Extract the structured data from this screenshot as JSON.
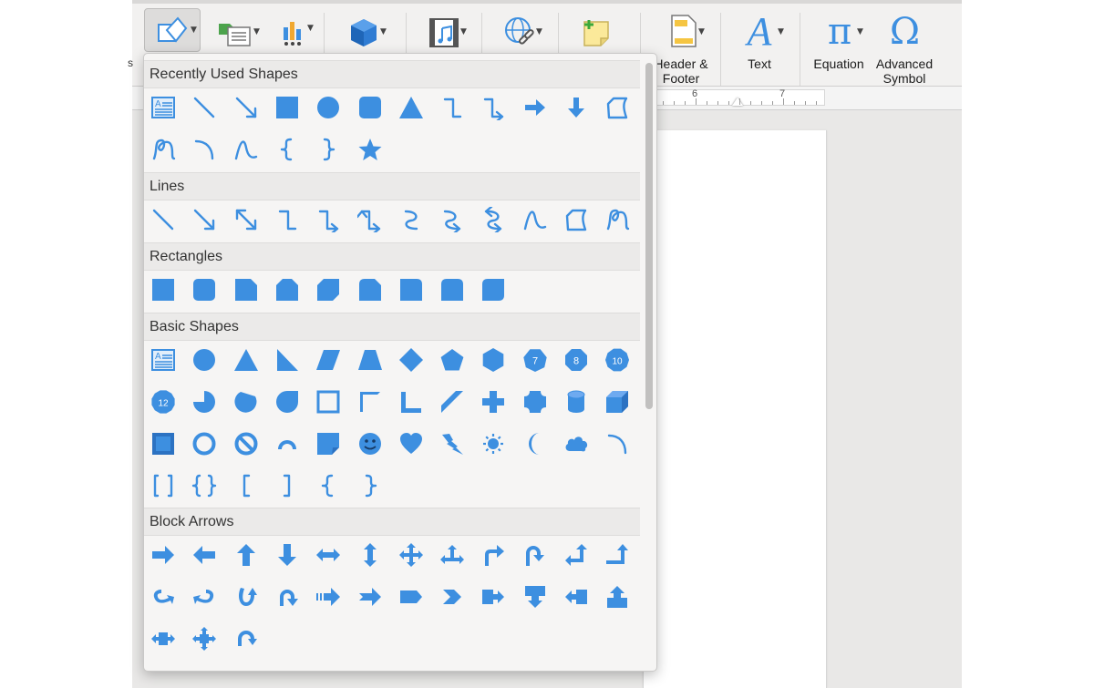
{
  "ribbon": {
    "buttons": [
      {
        "name": "shapes",
        "icon": "shapes-icon"
      },
      {
        "name": "smartart",
        "icon": "smartart-icon"
      },
      {
        "name": "chart",
        "icon": "chart-icon"
      },
      {
        "name": "3d-models",
        "icon": "3d-cube-icon"
      },
      {
        "name": "media",
        "icon": "video-icon"
      },
      {
        "name": "links",
        "icon": "link-icon"
      },
      {
        "name": "comment",
        "icon": "comment-icon"
      },
      {
        "name": "header-footer",
        "icon": "header-footer-icon",
        "label1": "Header &",
        "label2": "Footer"
      },
      {
        "name": "text",
        "icon": "text-icon",
        "label1": "Text"
      },
      {
        "name": "equation",
        "icon": "equation-icon",
        "label1": "Equation"
      },
      {
        "name": "advanced-symbol",
        "icon": "omega-icon",
        "label1": "Advanced",
        "label2": "Symbol"
      }
    ],
    "text_glyph": "A",
    "equation_glyph": "π",
    "symbol_glyph": "Ω"
  },
  "ruler": {
    "numbers": [
      "6",
      "7"
    ]
  },
  "panel": {
    "sections": [
      {
        "title": "Recently Used Shapes",
        "rows": [
          [
            "text-box-icon",
            "line-icon",
            "arrow-line-icon",
            "rectangle-icon",
            "oval-icon",
            "rounded-rectangle-icon",
            "triangle-icon",
            "elbow-connector-icon",
            "elbow-arrow-connector-icon",
            "right-arrow-icon",
            "down-arrow-icon",
            "freeform-icon"
          ],
          [
            "scribble-icon",
            "arc-icon",
            "curve-icon",
            "left-brace-icon",
            "right-brace-icon",
            "star-icon"
          ]
        ]
      },
      {
        "title": "Lines",
        "rows": [
          [
            "line-icon",
            "arrow-line-icon",
            "double-arrow-line-icon",
            "elbow-connector-icon",
            "elbow-arrow-connector-icon",
            "elbow-double-arrow-connector-icon",
            "curved-connector-icon",
            "curved-arrow-connector-icon",
            "curved-double-arrow-connector-icon",
            "curve-icon",
            "freeform-icon",
            "scribble-icon"
          ]
        ]
      },
      {
        "title": "Rectangles",
        "rows": [
          [
            "rectangle-icon",
            "rounded-rectangle-icon",
            "snip-single-corner-rectangle-icon",
            "snip-same-side-rectangle-icon",
            "snip-diagonal-rectangle-icon",
            "snip-round-rectangle-icon",
            "round-single-corner-rectangle-icon",
            "round-same-side-rectangle-icon",
            "round-diagonal-rectangle-icon"
          ]
        ]
      },
      {
        "title": "Basic Shapes",
        "rows": [
          [
            "text-box-icon",
            "oval-icon",
            "triangle-icon",
            "right-triangle-icon",
            "parallelogram-icon",
            "trapezoid-icon",
            "diamond-icon",
            "pentagon-icon",
            "hexagon-icon",
            "heptagon-icon",
            "octagon-icon",
            "decagon-icon"
          ],
          [
            "dodecagon-icon",
            "pie-icon",
            "chord-icon",
            "teardrop-icon",
            "frame-icon",
            "half-frame-icon",
            "l-shape-icon",
            "diagonal-stripe-icon",
            "cross-icon",
            "plaque-icon",
            "can-icon",
            "cube-icon"
          ],
          [
            "bevel-icon",
            "donut-icon",
            "no-symbol-icon",
            "block-arc-icon",
            "folded-corner-icon",
            "smiley-face-icon",
            "heart-icon",
            "lightning-bolt-icon",
            "sun-icon",
            "moon-icon",
            "cloud-icon",
            "arc-icon"
          ],
          [
            "double-bracket-icon",
            "double-brace-icon",
            "left-bracket-icon",
            "right-bracket-icon",
            "left-brace-icon",
            "right-brace-icon"
          ]
        ]
      },
      {
        "title": "Block Arrows",
        "rows": [
          [
            "right-block-arrow-icon",
            "left-block-arrow-icon",
            "up-block-arrow-icon",
            "down-block-arrow-icon",
            "left-right-arrow-icon",
            "up-down-arrow-icon",
            "quad-arrow-icon",
            "left-right-up-arrow-icon",
            "bent-arrow-icon",
            "u-turn-arrow-icon",
            "left-up-arrow-icon",
            "bent-up-arrow-icon"
          ],
          [
            "curved-right-arrow-icon",
            "curved-left-arrow-icon",
            "curved-up-arrow-icon",
            "curved-down-arrow-icon",
            "striped-right-arrow-icon",
            "notched-right-arrow-icon",
            "pentagon-arrow-icon",
            "chevron-icon",
            "right-arrow-callout-icon",
            "down-arrow-callout-icon",
            "left-arrow-callout-icon",
            "up-arrow-callout-icon"
          ],
          [
            "left-right-arrow-callout-icon",
            "quad-arrow-callout-icon",
            "circular-arrow-icon"
          ]
        ]
      }
    ],
    "polygon_numbers": {
      "heptagon": "7",
      "octagon": "8",
      "decagon": "10",
      "dodecagon": "12"
    }
  },
  "colors": {
    "shape_blue": "#3d8fe0",
    "panel_bg": "#f6f5f4",
    "header_bg": "#ebeae9"
  }
}
